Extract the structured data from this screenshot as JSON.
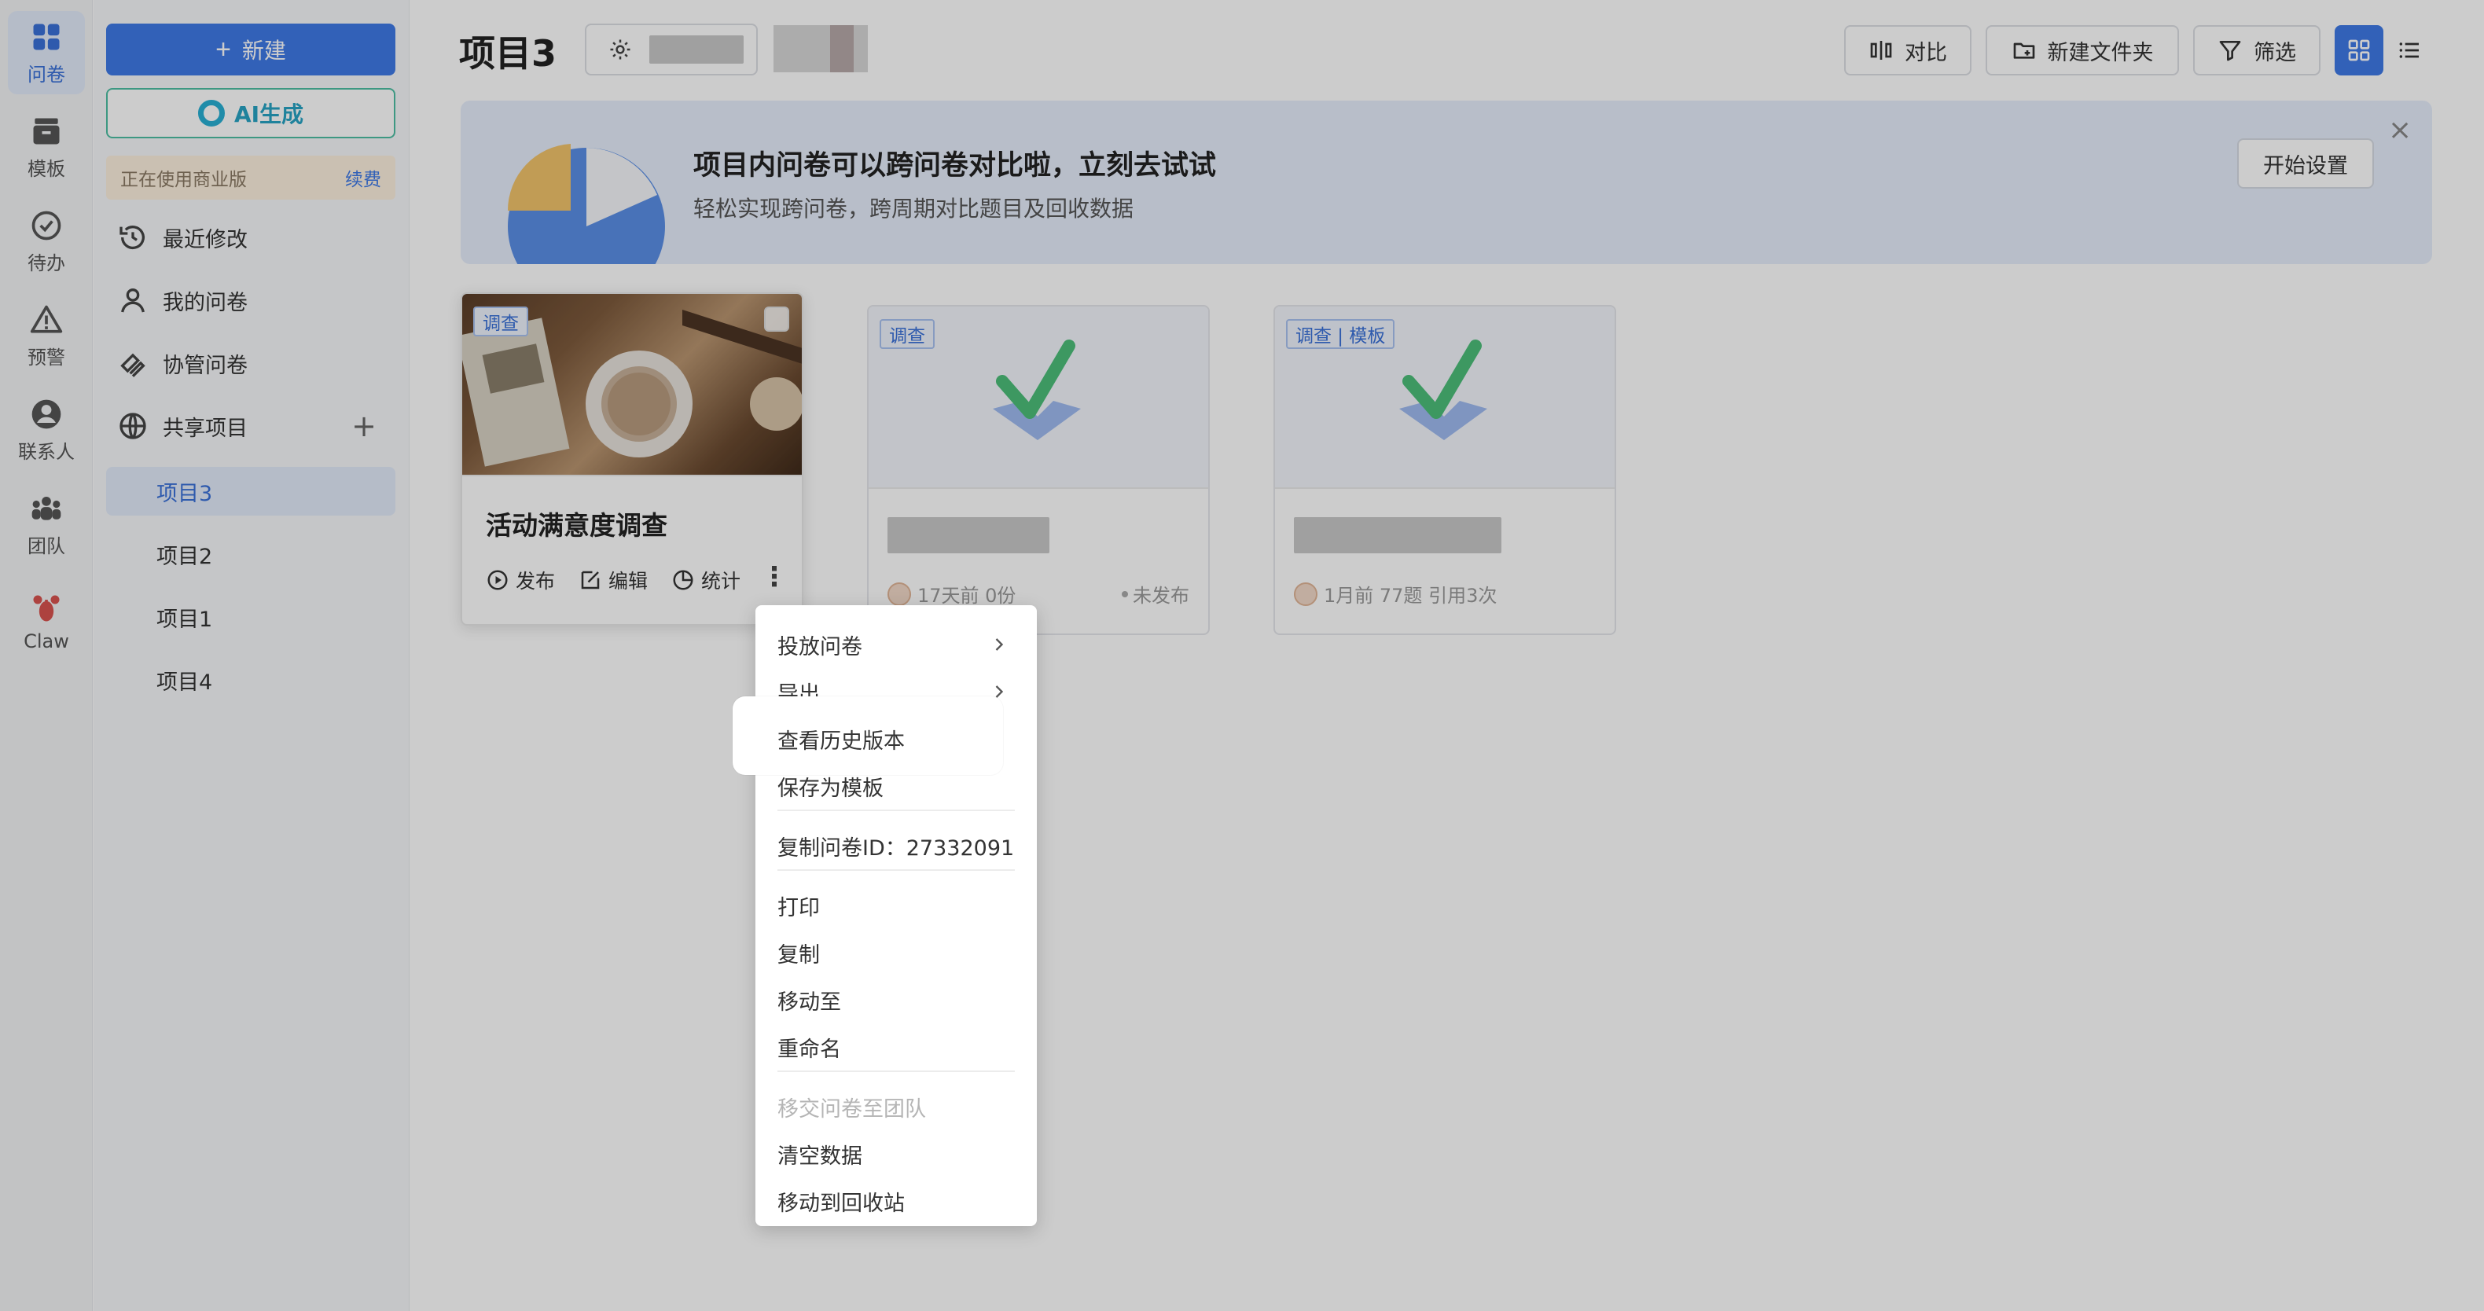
{
  "rail": {
    "items": [
      {
        "label": "问卷",
        "icon": "grid-icon",
        "active": true
      },
      {
        "label": "模板",
        "icon": "archive-icon"
      },
      {
        "label": "待办",
        "icon": "check-circle-icon"
      },
      {
        "label": "预警",
        "icon": "warning-icon"
      },
      {
        "label": "联系人",
        "icon": "contact-icon"
      },
      {
        "label": "团队",
        "icon": "team-icon"
      },
      {
        "label": "Claw",
        "icon": "lobster-icon"
      }
    ]
  },
  "panel": {
    "new_label": "新建",
    "ai_label": "AI生成",
    "biz_text": "正在使用商业版",
    "renew_label": "续费",
    "nav": [
      {
        "label": "最近修改",
        "icon": "history-icon"
      },
      {
        "label": "我的问卷",
        "icon": "user-icon"
      },
      {
        "label": "协管问卷",
        "icon": "collab-icon"
      },
      {
        "label": "共享项目",
        "icon": "globe-icon"
      }
    ],
    "add_symbol": "+",
    "projects": [
      {
        "label": "项目3",
        "active": true
      },
      {
        "label": "项目2"
      },
      {
        "label": "项目1"
      },
      {
        "label": "项目4"
      }
    ]
  },
  "header": {
    "title": "项目3",
    "compare_label": "对比",
    "new_folder_label": "新建文件夹",
    "filter_label": "筛选"
  },
  "banner": {
    "title": "项目内问卷可以跨问卷对比啦，立刻去试试",
    "subtitle": "轻松实现跨问卷，跨周期对比题目及回收数据",
    "button_label": "开始设置",
    "close_symbol": "×"
  },
  "cards": [
    {
      "tag": "调查",
      "title": "活动满意度调查",
      "actions": {
        "publish": "发布",
        "edit": "编辑",
        "stats": "统计"
      },
      "more_symbol": "⋮"
    },
    {
      "tag": "调查",
      "meta": "17天前 0份",
      "status": "未发布"
    },
    {
      "tag": "调查 | 模板",
      "meta": "1月前 77题 引用3次"
    }
  ],
  "context_menu": {
    "items": [
      {
        "label": "投放问卷",
        "submenu": true
      },
      {
        "label": "导出",
        "submenu": true
      },
      {
        "label": "查看历史版本"
      },
      {
        "label": "保存为模板"
      },
      {
        "label": "复制问卷ID：27332091"
      },
      {
        "label": "打印"
      },
      {
        "label": "复制"
      },
      {
        "label": "移动至"
      },
      {
        "label": "重命名"
      },
      {
        "label": "移交问卷至团队",
        "disabled": true
      },
      {
        "label": "清空数据"
      },
      {
        "label": "移动到回收站"
      }
    ]
  },
  "colors": {
    "accent": "#3f7ae6",
    "ai_border": "#4dbfa3",
    "banner_bg": "#e6eefc"
  }
}
